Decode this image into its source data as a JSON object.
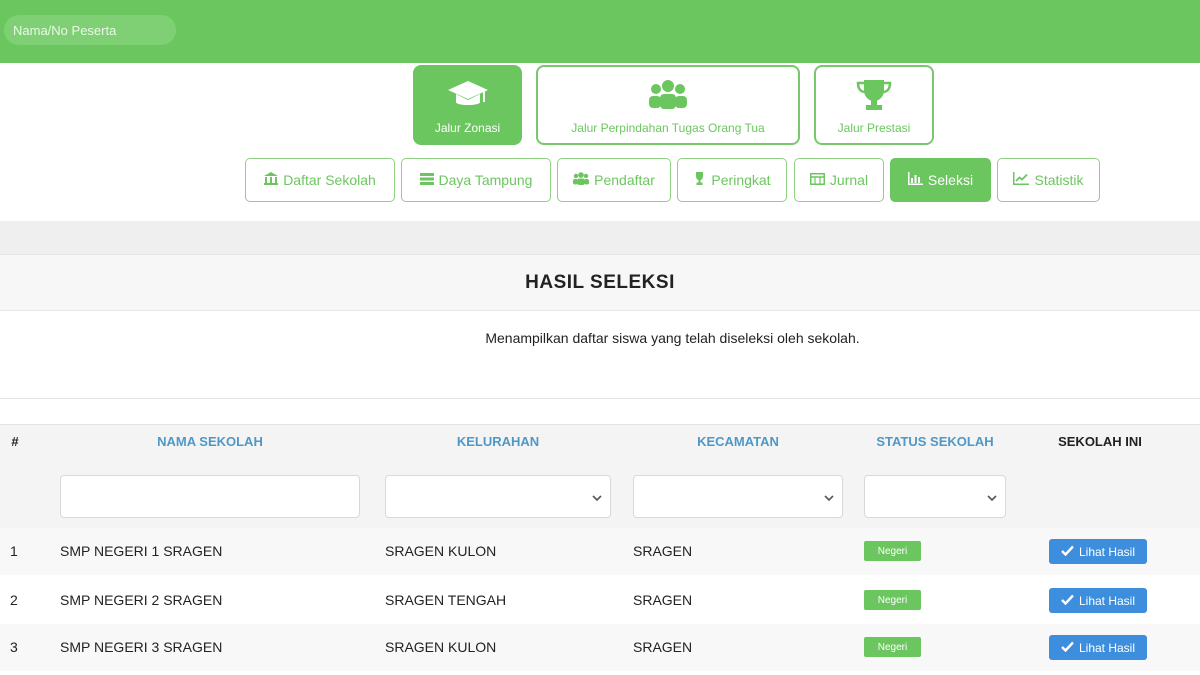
{
  "search": {
    "placeholder": "Nama/No Peserta"
  },
  "jalur": [
    {
      "label": "Jalur Zonasi",
      "icon": "graduation-cap-icon",
      "active": true
    },
    {
      "label": "Jalur Perpindahan Tugas Orang Tua",
      "icon": "users-icon",
      "active": false
    },
    {
      "label": "Jalur Prestasi",
      "icon": "trophy-icon",
      "active": false
    }
  ],
  "tabs": [
    {
      "label": "Daftar Sekolah",
      "icon": "building-icon",
      "active": false
    },
    {
      "label": "Daya Tampung",
      "icon": "list-icon",
      "active": false
    },
    {
      "label": "Pendaftar",
      "icon": "users-icon",
      "active": false
    },
    {
      "label": "Peringkat",
      "icon": "trophy-icon",
      "active": false
    },
    {
      "label": "Jurnal",
      "icon": "table-icon",
      "active": false
    },
    {
      "label": "Seleksi",
      "icon": "bar-chart-icon",
      "active": true
    },
    {
      "label": "Statistik",
      "icon": "line-chart-icon",
      "active": false
    }
  ],
  "panel": {
    "title": "HASIL SELEKSI",
    "description": "Menampilkan daftar siswa yang telah diseleksi oleh sekolah."
  },
  "table": {
    "columns": [
      "#",
      "NAMA SEKOLAH",
      "KELURAHAN",
      "KECAMATAN",
      "STATUS SEKOLAH",
      "SEKOLAH INI"
    ],
    "rows": [
      {
        "no": "1",
        "nama": "SMP NEGERI 1 SRAGEN",
        "kelurahan": "SRAGEN KULON",
        "kecamatan": "SRAGEN",
        "status": "Negeri",
        "action": "Lihat Hasil"
      },
      {
        "no": "2",
        "nama": "SMP NEGERI 2 SRAGEN",
        "kelurahan": "SRAGEN TENGAH",
        "kecamatan": "SRAGEN",
        "status": "Negeri",
        "action": "Lihat Hasil"
      },
      {
        "no": "3",
        "nama": "SMP NEGERI 3 SRAGEN",
        "kelurahan": "SRAGEN KULON",
        "kecamatan": "SRAGEN",
        "status": "Negeri",
        "action": "Lihat Hasil"
      }
    ]
  },
  "colors": {
    "primary_green": "#6cc65f",
    "header_blue": "#4f98c6",
    "button_blue": "#3e8ede"
  }
}
